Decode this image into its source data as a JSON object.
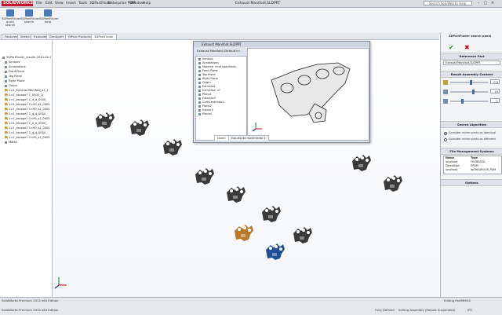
{
  "app": {
    "logo": "SOLIDWORKS",
    "menu": [
      "File",
      "Edit",
      "View",
      "Insert",
      "Tools",
      "3DPartFinder",
      "Enterprise PDM",
      "Window",
      "Help"
    ],
    "doc_title": "Exhaust Manifold.SLDPRT",
    "search_placeholder": "Search SolidWorks Help"
  },
  "ribbon": {
    "buttons": [
      "3DPartFinder quick search",
      "3DPartFinder search",
      "3DPartFinder help"
    ]
  },
  "tabs": [
    "Features",
    "Sketch",
    "Evaluate",
    "DimXpert",
    "Office Products",
    "3DPartFinder"
  ],
  "tree": {
    "items": [
      "3DPartFinder_results_2012-04-1",
      "Sensors",
      "Annotations",
      "Front Plane",
      "Top Plane",
      "Right Plane",
      "Origin",
      "(-) 1<1_Exhaust Manifold_s3_1",
      "(-) 1<1_escape7 1_0000_1(",
      "(-) 1<1_escape7 1_d_d_0000_",
      "(-) 1<1_escape7 1<90_s1_0000",
      "(-) 1<1_escape7 1<90_s1_0000",
      "(-) 1<1_escape7 1_d_d_0000_",
      "(-) 1<1_escape7 1<90_s1_0000",
      "(-) 1<1_escape7 1_d_d_0000_",
      "(-) 1<1_escape7 1<90_s1_0000",
      "(-) 1<1_escape7 1_d_d_0000_",
      "(-) 1<1_escape7 1<90_s1_0000",
      "Mates"
    ]
  },
  "inner_window": {
    "title": "Exhaust Manifold.SLDPRT",
    "tree_root": "Exhaust Manifold (Default<<",
    "tree_items": [
      "Sensors",
      "Annotations",
      "Material <not specified>",
      "Front Plane",
      "Top Plane",
      "Right Plane",
      "Origin",
      "Extruido1",
      "Extruido2 <?",
      "Plano1",
      "Extruido3",
      "Corte-extruido1",
      "Plano2",
      "Extruir5",
      "Plano4"
    ],
    "tabs": [
      "Model",
      "Estudio de movimiento 1"
    ]
  },
  "panel": {
    "title": "3DPartFinder search panel",
    "reference_header": "Reference Part",
    "reference_value": "Exhaust Manifold.SLDPRT",
    "result_header": "Result Assembly Content",
    "rows": [
      {
        "value": "0.9"
      },
      {
        "value": "15"
      },
      {
        "value": "1"
      }
    ],
    "slider_levels": [
      0.55,
      0.62,
      0.3
    ],
    "algo_header": "Search Algorithm",
    "algo_options": [
      "Consider mirror parts as identical",
      "Consider mirror parts as different"
    ],
    "algo_selected": 0,
    "fms_header": "File Management Systems",
    "fms_columns": [
      "Name",
      "Type"
    ],
    "fms_rows": [
      [
        "localhost",
        "FILEBASED"
      ],
      [
        "Demoflash",
        "EPDM"
      ],
      [
        "localhost",
        "WORKGROUP_PDM"
      ]
    ],
    "options_header": "Options"
  },
  "status": {
    "left_line1": "SolidWorks Premium 2012 x64 Edition",
    "left_line2": "SolidWorks Premium 2012 x64 Edition",
    "right_items": [
      "Fully Defined",
      "Editing Assembly (Rebuilt Suspended)",
      "IPS"
    ],
    "editing_part": "Editing Part",
    "mmgs": "MMGS"
  },
  "colors": {
    "accent": "#c8102e",
    "part_gray": "#3a3a3a",
    "part_orange": "#b87a2a",
    "part_blue": "#1f4f9a"
  }
}
